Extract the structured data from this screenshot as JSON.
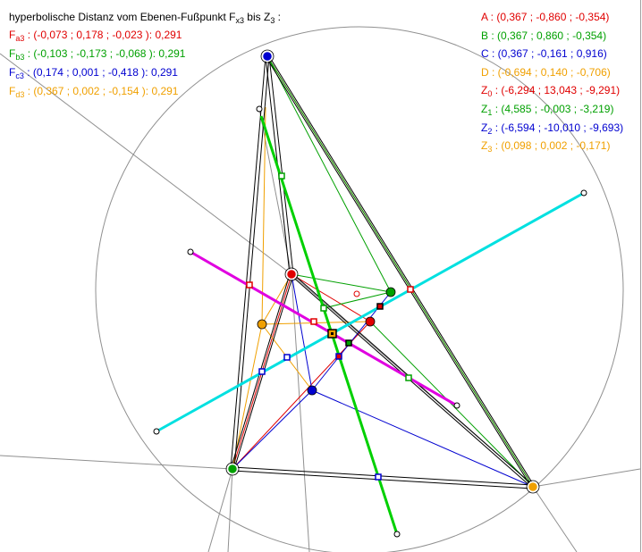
{
  "title": {
    "prefix": "hyperbolische Distanz vom Ebenen-Fußpunkt F",
    "sub": "x3",
    "mid": " bis Z",
    "sub2": "3",
    "suffix": " :"
  },
  "distances": [
    {
      "base": "F",
      "sub": "a3",
      "text": " : (-0,073 ; 0,178 ; -0,023 ): 0,291",
      "color": "#e00000"
    },
    {
      "base": "F",
      "sub": "b3",
      "text": " : (-0,103 ; -0,173 ; -0,068 ): 0,291",
      "color": "#00a000"
    },
    {
      "base": "F",
      "sub": "c3",
      "text": " : (0,174 ; 0,001 ; -0,418 ): 0,291",
      "color": "#0000d0"
    },
    {
      "base": "F",
      "sub": "d3",
      "text": " : (0,367 ; 0,002 ; -0,154 ): 0,291",
      "color": "#f0a000"
    }
  ],
  "points": [
    {
      "base": "A",
      "sub": "",
      "text": " : (0,367 ; -0,860 ; -0,354)",
      "color": "#e00000"
    },
    {
      "base": "B",
      "sub": "",
      "text": " : (0,367 ; 0,860 ; -0,354)",
      "color": "#00a000"
    },
    {
      "base": "C",
      "sub": "",
      "text": " : (0,367 ; -0,161 ; 0,916)",
      "color": "#0000d0"
    },
    {
      "base": "D",
      "sub": "",
      "text": " : (-0,694 ; 0,140 ; -0,706)",
      "color": "#f0a000"
    },
    {
      "base": "Z",
      "sub": "0",
      "text": " : (-6,294 ; 13,043 ; -9,291)",
      "color": "#e00000"
    },
    {
      "base": "Z",
      "sub": "1",
      "text": " : (4,585 ; -0,003 ; -3,219)",
      "color": "#00a000"
    },
    {
      "base": "Z",
      "sub": "2",
      "text": " : (-6,594 ; -10,010 ; -9,693)",
      "color": "#0000d0"
    },
    {
      "base": "Z",
      "sub": "3",
      "text": " : (0,098 ; 0,002 ; -0,171)",
      "color": "#f0a000"
    }
  ]
}
